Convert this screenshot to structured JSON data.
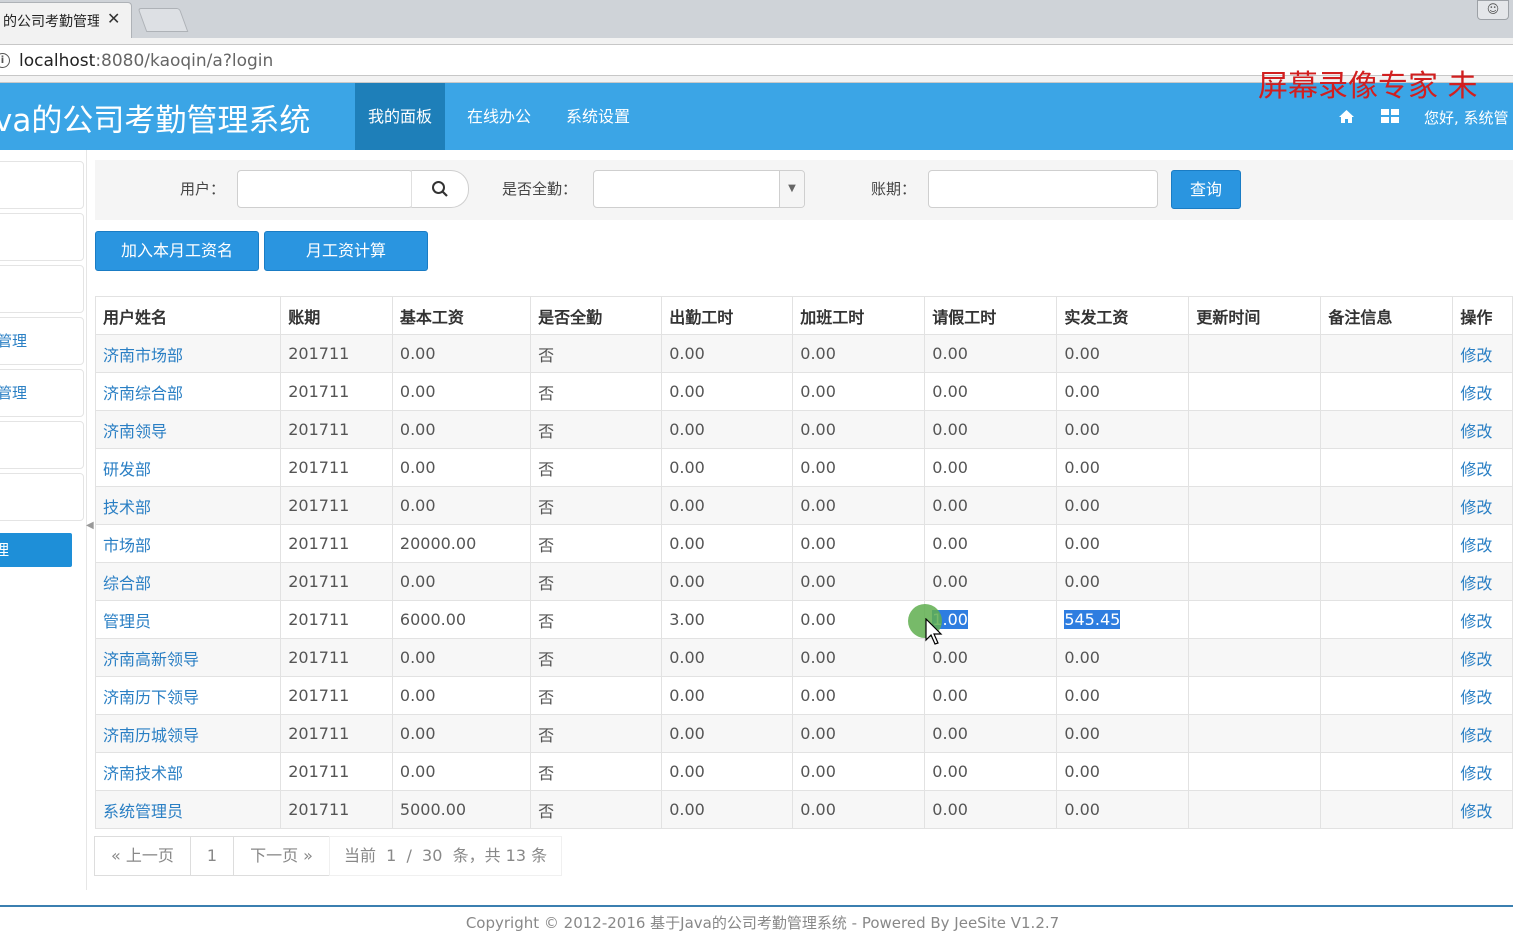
{
  "browser": {
    "tab_title": "的公司考勤管理",
    "tab_close": "✕",
    "url_host": "localhost",
    "url_rest": ":8080/kaoqin/a?login"
  },
  "header": {
    "brand": "va的公司考勤管理系统",
    "nav": [
      "我的面板",
      "在线办公",
      "系统设置"
    ],
    "watermark": "屏幕录像专家 未",
    "greeting": "您好, 系统管",
    "accent_color": "#3ba5e6"
  },
  "sidebar": {
    "items": [
      "",
      "",
      "",
      "管理",
      "管理",
      "",
      ""
    ],
    "active_label": "理"
  },
  "search": {
    "user_label": "用户：",
    "user_value": "",
    "full_attendance_label": "是否全勤：",
    "full_attendance_value": "",
    "period_label": "账期：",
    "period_value": "",
    "query_button": "查询"
  },
  "actions": {
    "add_month_button": "加入本月工资名",
    "calc_button": "月工资计算"
  },
  "table": {
    "headers": [
      "用户姓名",
      "账期",
      "基本工资",
      "是否全勤",
      "出勤工时",
      "加班工时",
      "请假工时",
      "实发工资",
      "更新时间",
      "备注信息",
      "操作"
    ],
    "rows": [
      [
        "济南市场部",
        "201711",
        "0.00",
        "否",
        "0.00",
        "0.00",
        "0.00",
        "0.00",
        "",
        "",
        "修改"
      ],
      [
        "济南综合部",
        "201711",
        "0.00",
        "否",
        "0.00",
        "0.00",
        "0.00",
        "0.00",
        "",
        "",
        "修改"
      ],
      [
        "济南领导",
        "201711",
        "0.00",
        "否",
        "0.00",
        "0.00",
        "0.00",
        "0.00",
        "",
        "",
        "修改"
      ],
      [
        "研发部",
        "201711",
        "0.00",
        "否",
        "0.00",
        "0.00",
        "0.00",
        "0.00",
        "",
        "",
        "修改"
      ],
      [
        "技术部",
        "201711",
        "0.00",
        "否",
        "0.00",
        "0.00",
        "0.00",
        "0.00",
        "",
        "",
        "修改"
      ],
      [
        "市场部",
        "201711",
        "20000.00",
        "否",
        "0.00",
        "0.00",
        "0.00",
        "0.00",
        "",
        "",
        "修改"
      ],
      [
        "综合部",
        "201711",
        "0.00",
        "否",
        "0.00",
        "0.00",
        "0.00",
        "0.00",
        "",
        "",
        "修改"
      ],
      [
        "管理员",
        "201711",
        "6000.00",
        "否",
        "3.00",
        "0.00",
        "1.00",
        "545.45",
        "",
        "",
        "修改"
      ],
      [
        "济南高新领导",
        "201711",
        "0.00",
        "否",
        "0.00",
        "0.00",
        "0.00",
        "0.00",
        "",
        "",
        "修改"
      ],
      [
        "济南历下领导",
        "201711",
        "0.00",
        "否",
        "0.00",
        "0.00",
        "0.00",
        "0.00",
        "",
        "",
        "修改"
      ],
      [
        "济南历城领导",
        "201711",
        "0.00",
        "否",
        "0.00",
        "0.00",
        "0.00",
        "0.00",
        "",
        "",
        "修改"
      ],
      [
        "济南技术部",
        "201711",
        "0.00",
        "否",
        "0.00",
        "0.00",
        "0.00",
        "0.00",
        "",
        "",
        "修改"
      ],
      [
        "系统管理员",
        "201711",
        "5000.00",
        "否",
        "0.00",
        "0.00",
        "0.00",
        "0.00",
        "",
        "",
        "修改"
      ]
    ]
  },
  "pagination": {
    "prev": "« 上一页",
    "page": "1",
    "next": "下一页 »",
    "info": "当前  1  /  30  条，共 13 条"
  },
  "footer": {
    "text": "Copyright © 2012-2016 基于Java的公司考勤管理系统 - Powered By JeeSite V1.2.7"
  }
}
